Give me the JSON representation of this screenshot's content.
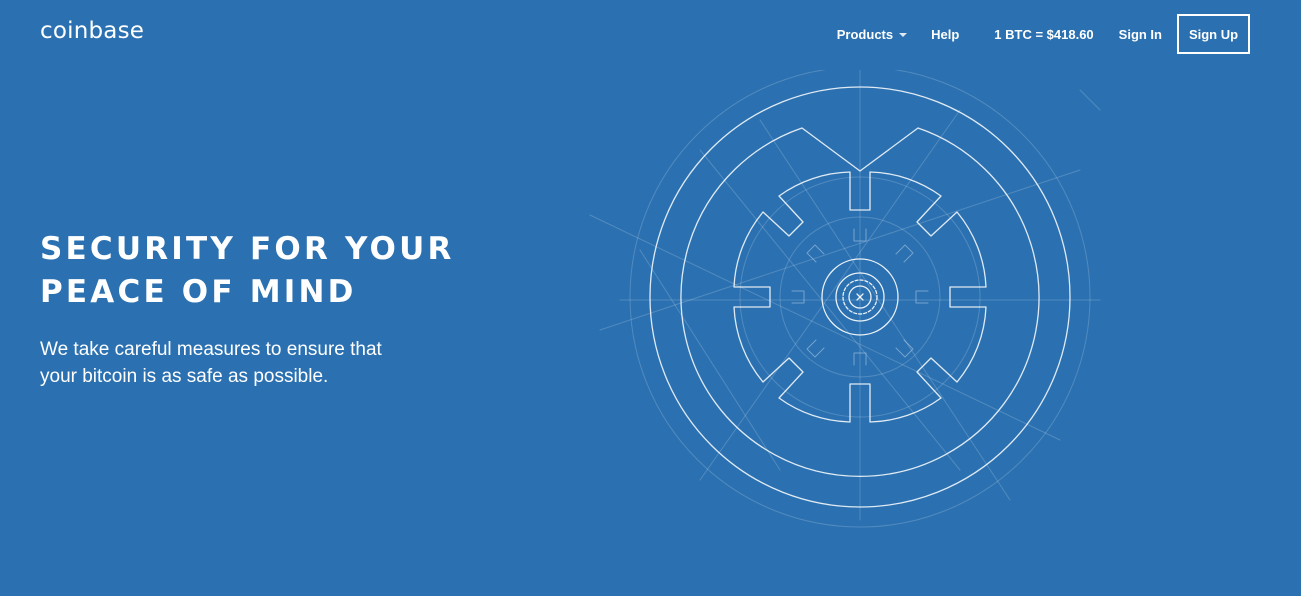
{
  "header": {
    "logo_text": "coinbase",
    "nav": {
      "products_label": "Products",
      "help_label": "Help",
      "btc_price": "1 BTC = $418.60",
      "signin_label": "Sign In",
      "signup_label": "Sign Up"
    }
  },
  "hero": {
    "title_line1": "SECURITY FOR YOUR",
    "title_line2": "PEACE OF MIND",
    "subtitle_line1": "We take careful measures to ensure that",
    "subtitle_line2": "your bitcoin is as safe as possible."
  },
  "colors": {
    "background": "#2b71b1",
    "foreground": "#ffffff"
  },
  "icons": {
    "products_dropdown": "caret-down-icon",
    "illustration": "vault-illustration"
  }
}
